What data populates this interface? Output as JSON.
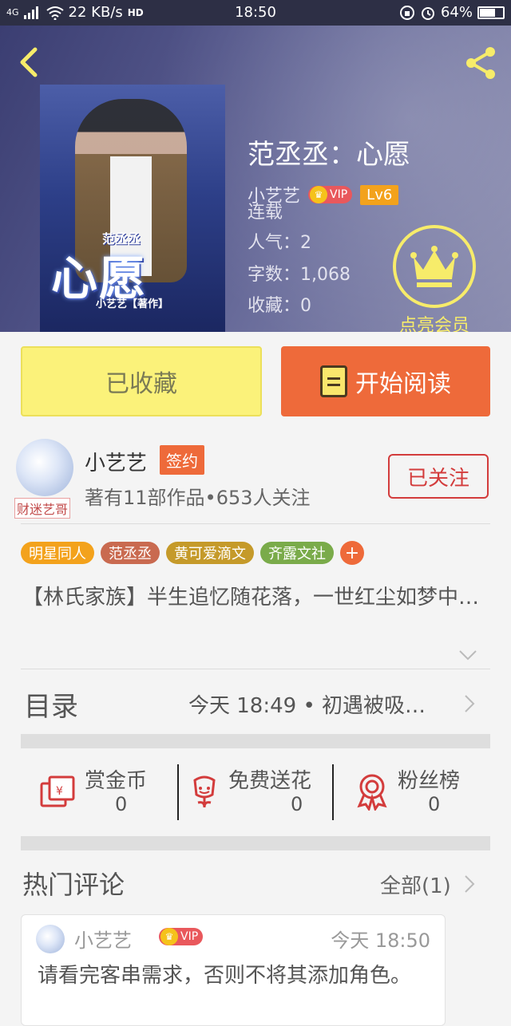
{
  "status_bar": {
    "network": "4G",
    "speed": "22 KB/s",
    "hd": "HD",
    "time": "18:50",
    "battery": "64%"
  },
  "header": {
    "book_title": "范丞丞：心愿",
    "author": "小艺艺",
    "vip_label": "VIP",
    "level": "Lv6",
    "status": "连载",
    "popularity": "人气：2",
    "word_count": "字数：1,068",
    "favorites": "收藏：0",
    "vip_cta": "点亮会员",
    "cover": {
      "logo_text": "心愿",
      "logo_top": "范丞丞",
      "author_tag": "小艺艺【著作】"
    }
  },
  "actions": {
    "favorited_label": "已收藏",
    "read_label": "开始阅读"
  },
  "author_card": {
    "avatar_caption": "财迷艺哥",
    "name": "小艺艺",
    "signed_badge": "签约",
    "info": "著有11部作品•653人关注",
    "follow_label": "已关注"
  },
  "tags": [
    {
      "label": "明星同人",
      "color": "#f3a21c"
    },
    {
      "label": "范丞丞",
      "color": "#c96a50"
    },
    {
      "label": "黄可爱滴文",
      "color": "#c59a2a"
    },
    {
      "label": "齐露文社",
      "color": "#7aab4a"
    }
  ],
  "tag_add": "+",
  "description": "【林氏家族】半生追忆随花落，一世红尘如梦中…",
  "toc": {
    "label": "目录",
    "latest": "今天 18:49 • 初遇被吸…"
  },
  "stats": [
    {
      "label": "赏金币",
      "value": "0",
      "icon": "gift-envelope-icon"
    },
    {
      "label": "免费送花",
      "value": "0",
      "icon": "flower-icon"
    },
    {
      "label": "粉丝榜",
      "value": "0",
      "icon": "medal-icon"
    }
  ],
  "comments_section": {
    "label": "热门评论",
    "all_label": "全部(1)",
    "comment": {
      "user": "小艺艺",
      "vip_label": "VIP",
      "time": "今天 18:50",
      "text": "请看完客串需求，否则不将其添加角色。"
    }
  },
  "colors": {
    "accent_orange": "#ee6a3a",
    "favorite_yellow": "#fbf27a",
    "follow_red": "#d33c3c",
    "vip_gold": "#f7ec6a"
  }
}
